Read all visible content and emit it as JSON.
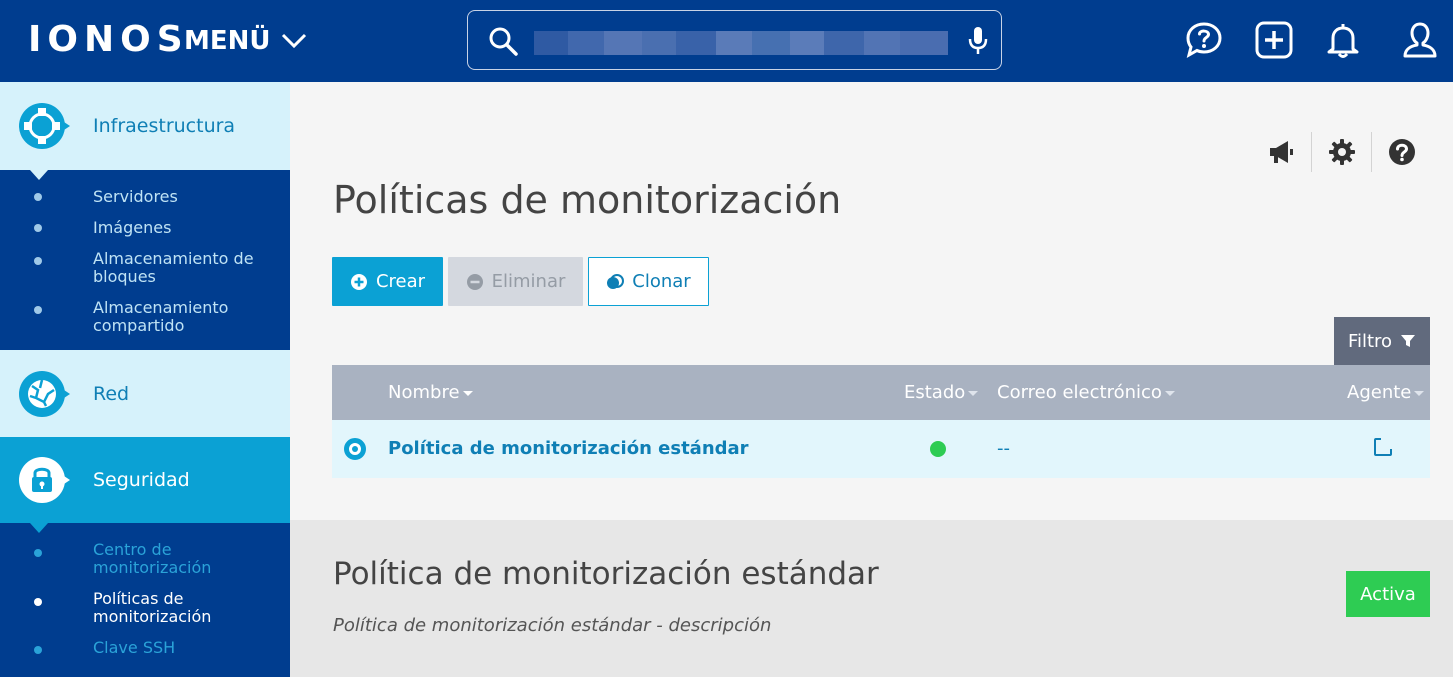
{
  "header": {
    "logo": "IONOS",
    "menu_label": "MENÜ",
    "search": {
      "value": "",
      "placeholder": ""
    }
  },
  "sidebar": {
    "sections": [
      {
        "label": "Infraestructura",
        "icon": "infrastructure-icon",
        "items": [
          {
            "label": "Servidores"
          },
          {
            "label": "Imágenes"
          },
          {
            "label": "Almacenamiento de bloques"
          },
          {
            "label": "Almacenamiento compartido"
          }
        ]
      },
      {
        "label": "Red",
        "icon": "network-globe-icon",
        "items": []
      },
      {
        "label": "Seguridad",
        "icon": "lock-icon",
        "active": true,
        "items": [
          {
            "label": "Centro de monitorización"
          },
          {
            "label": "Políticas de monitorización",
            "current": true
          },
          {
            "label": "Clave SSH"
          }
        ]
      }
    ]
  },
  "main": {
    "title": "Políticas de monitorización",
    "buttons": {
      "create": "Crear",
      "delete": "Eliminar",
      "clone": "Clonar"
    },
    "filter_label": "Filtro",
    "table": {
      "columns": [
        "Nombre",
        "Estado",
        "Correo electrónico",
        "Agente"
      ],
      "rows": [
        {
          "name": "Política de monitorización estándar",
          "status": "active",
          "email": "--",
          "agent": "external-link-icon"
        }
      ]
    }
  },
  "detail": {
    "title": "Política de monitorización estándar",
    "description": "Política de monitorización estándar - descripción",
    "status_badge": "Activa"
  },
  "colors": {
    "brand_navy": "#003d8f",
    "accent_blue": "#0ba1d4",
    "status_green": "#2ecc53",
    "table_header": "#a9b2c1"
  }
}
